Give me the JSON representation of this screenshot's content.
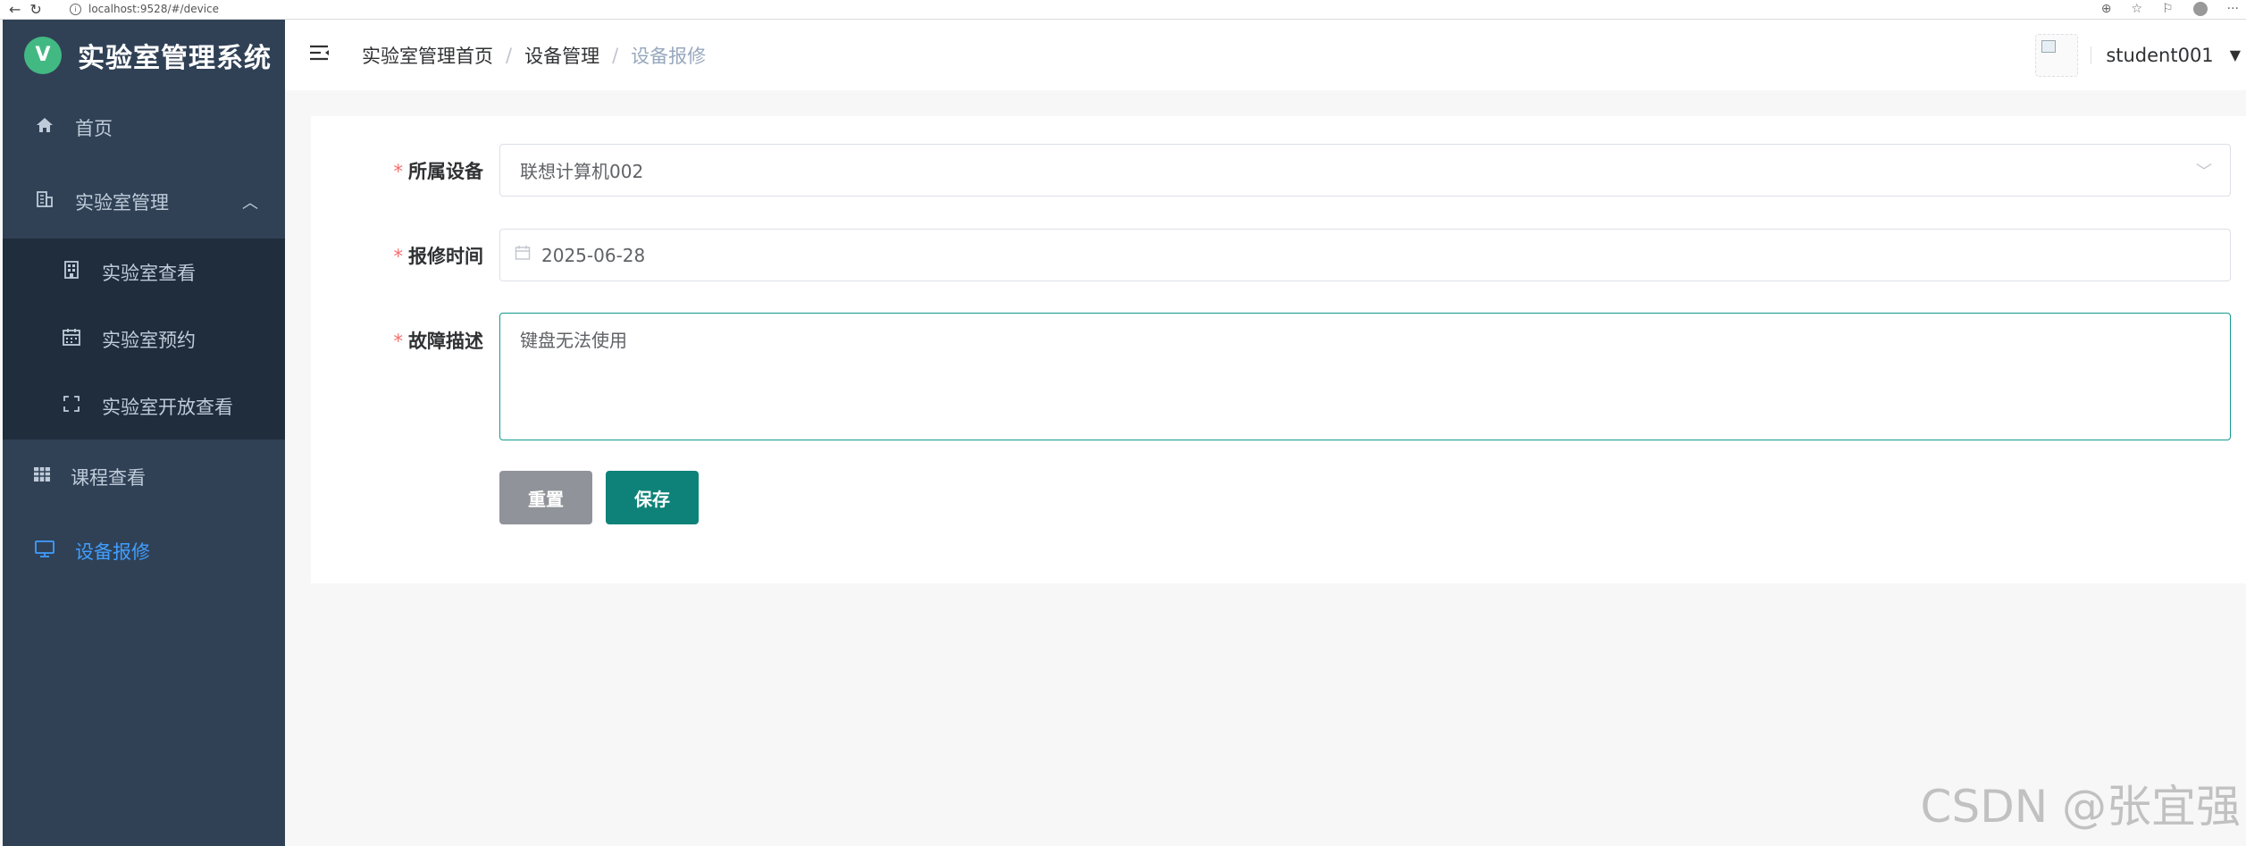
{
  "browser": {
    "url": "localhost:9528/#/device",
    "back_icon": "arrow-left-icon",
    "reload_icon": "reload-icon"
  },
  "sidebar": {
    "logo_letter": "V",
    "title": "实验室管理系统",
    "items": [
      {
        "label": "首页",
        "icon": "home-icon"
      },
      {
        "label": "实验室管理",
        "icon": "building-icon",
        "expanded": true,
        "children": [
          {
            "label": "实验室查看",
            "icon": "office-icon"
          },
          {
            "label": "实验室预约",
            "icon": "calendar-icon"
          },
          {
            "label": "实验室开放查看",
            "icon": "fullscreen-icon"
          }
        ]
      },
      {
        "label": "课程查看",
        "icon": "grid-icon"
      },
      {
        "label": "设备报修",
        "icon": "monitor-icon",
        "active": true
      }
    ]
  },
  "header": {
    "breadcrumb": [
      "实验室管理首页",
      "设备管理",
      "设备报修"
    ],
    "username": "student001"
  },
  "form": {
    "device_label": "所属设备",
    "device_value": "联想计算机002",
    "time_label": "报修时间",
    "time_value": "2025-06-28",
    "desc_label": "故障描述",
    "desc_value": "键盘无法使用",
    "reset_label": "重置",
    "save_label": "保存",
    "required_mark": "*"
  },
  "watermark": "CSDN @张宜强",
  "colors": {
    "sidebar_bg": "#304156",
    "submenu_bg": "#1f2d3d",
    "active": "#409eff",
    "save_button": "#0e8278",
    "reset_button": "#909399",
    "required": "#f56c6c"
  }
}
